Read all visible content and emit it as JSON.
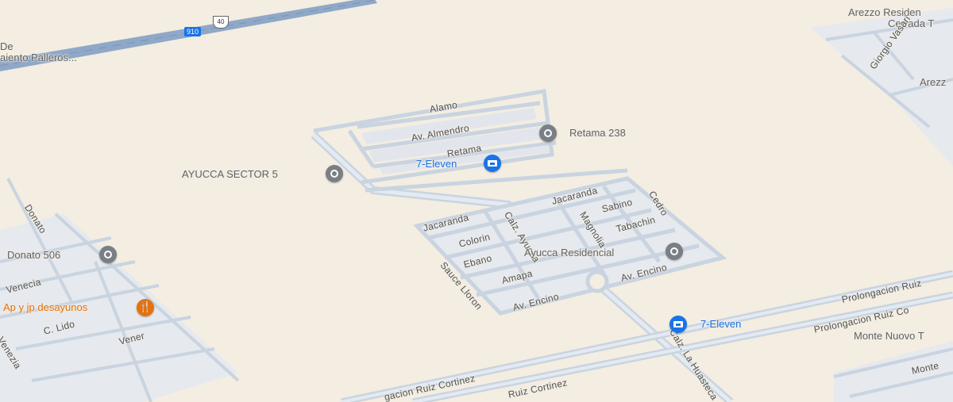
{
  "map": {
    "highway": {
      "shield_number": "910",
      "route_number": "40"
    },
    "partial_labels": {
      "top_left_1": "De",
      "top_left_2": "aiento Palleros...",
      "top_right_1": "Arezzo Residen",
      "top_right_2": "Cerrada T",
      "top_right_3": "Arezz",
      "right_street": "Giorgio Vasari",
      "monte_nuovo": "Monte Nuovo T",
      "monte_right": "Monte"
    },
    "streets": {
      "alamo": "Alamo",
      "almendro": "Av. Almendro",
      "retama": "Retama",
      "jacaranda_left": "Jacaranda",
      "jacaranda_right": "Jacaranda",
      "colorin": "Colorin",
      "ebano": "Ebano",
      "calz_ayucca": "Calz. Ayucca",
      "magnolia": "Magnolia",
      "sabino": "Sabino",
      "cedro": "Cedro",
      "tabachin": "Tabachin",
      "sauce_lloron": "Sauce Lloron",
      "amapa": "Amapa",
      "encino_left": "Av. Encino",
      "encino_right": "Av. Encino",
      "calz_huasteca": "Calz. La Huasteca",
      "ruiz_1": "Prolongacion Ruiz",
      "ruiz_2": "Prolongacion Ruiz Co",
      "ruiz_3": "Ruiz Cortinez",
      "ruiz_4": "gacion Ruiz Cortinez",
      "donato": "Donato",
      "venecia": "Venecia",
      "lido": "C. Lido",
      "vener": "Vener",
      "venezia2": "Venezia"
    },
    "places": {
      "retama238": "Retama 238",
      "eleven_top": "7-Eleven",
      "ayucca_sector": "AYUCCA SECTOR 5",
      "donato506": "Donato 506",
      "desayunos": "Ap y jp desayunos",
      "ayucca_residencial": "Ayucca Residencial",
      "eleven_bottom": "7-Eleven"
    },
    "icons": {
      "place_pin": "location-pin-icon",
      "store": "convenience-store-icon",
      "restaurant": "restaurant-icon"
    },
    "colors": {
      "land": "#f3ede2",
      "road": "#c9d4e0",
      "highway": "#8fa8c8",
      "block": "#e2e6ec",
      "store": "#1a73e8",
      "food": "#e8710a",
      "pin": "#7a7f85"
    }
  }
}
